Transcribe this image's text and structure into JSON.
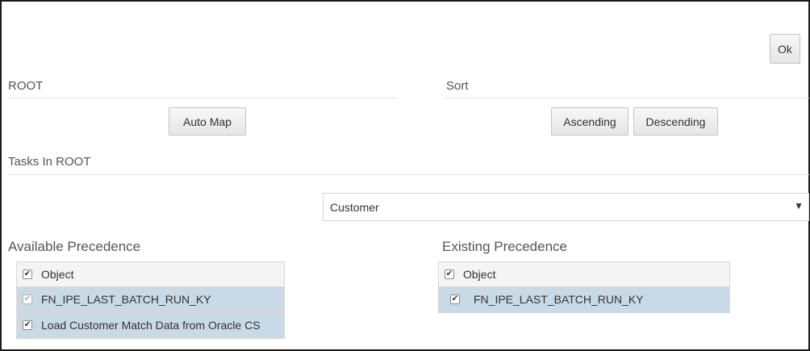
{
  "toolbar": {
    "ok_label": "Ok"
  },
  "root_section": {
    "title": "ROOT",
    "auto_map_label": "Auto Map"
  },
  "sort_section": {
    "title": "Sort",
    "ascending_label": "Ascending",
    "descending_label": "Descending"
  },
  "tasks_section": {
    "title": "Tasks In ROOT"
  },
  "task_select": {
    "selected": "Customer",
    "arrow": "▼"
  },
  "available": {
    "title": "Available Precedence",
    "header": "Object",
    "rows": [
      {
        "label": "FN_IPE_LAST_BATCH_RUN_KY",
        "checked": true,
        "selected": true,
        "dimmed": true
      },
      {
        "label": "Load Customer Match Data from Oracle CS",
        "checked": true,
        "selected": true,
        "dimmed": false
      }
    ]
  },
  "existing": {
    "title": "Existing Precedence",
    "header": "Object",
    "rows": [
      {
        "label": "FN_IPE_LAST_BATCH_RUN_KY",
        "checked": true,
        "selected": true,
        "dimmed": false
      }
    ]
  },
  "checkmark": "✔",
  "colors": {
    "selected_row": "#c9d9e6",
    "header_row": "#f4f4f4",
    "frame": "#1a1a1a"
  }
}
